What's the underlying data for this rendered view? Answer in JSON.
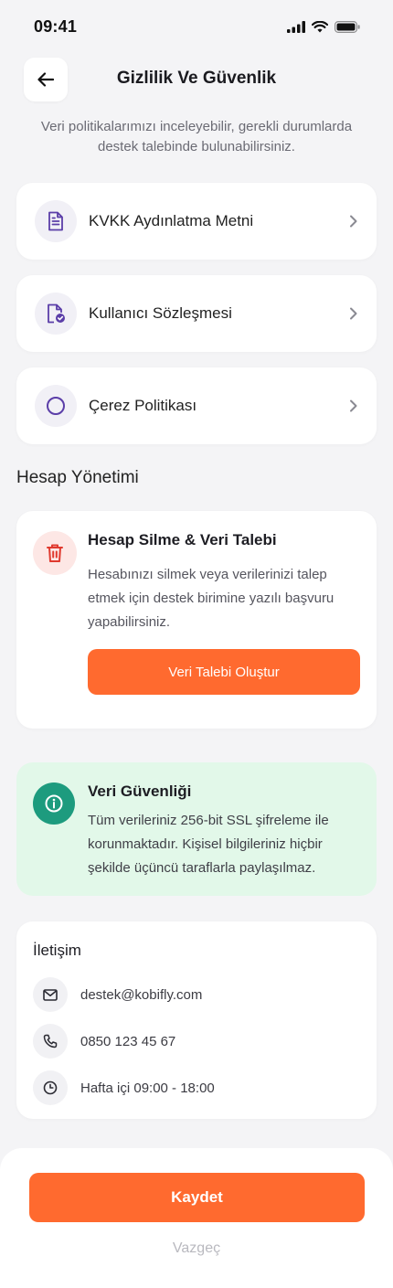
{
  "status_bar": {
    "time": "09:41"
  },
  "header": {
    "title": "Gizlilik Ve Güvenlik"
  },
  "subtitle": "Veri politikalarımızı inceleyebilir, gerekli durumlarda destek talebinde bulunabilirsiniz.",
  "menu_items": [
    {
      "label": "KVKK Aydınlatma Metni",
      "icon": "document-icon"
    },
    {
      "label": "Kullanıcı Sözleşmesi",
      "icon": "document-check-icon"
    },
    {
      "label": "Çerez Politikası",
      "icon": "circle-icon"
    }
  ],
  "account_section": {
    "title": "Hesap Yönetimi",
    "card_title": "Hesap Silme & Veri Talebi",
    "card_desc": "Hesabınızı silmek veya verilerinizi talep etmek için destek birimine yazılı başvuru yapabilirsiniz.",
    "button_label": "Veri Talebi Oluştur"
  },
  "security": {
    "title": "Veri Güvenliği",
    "desc": "Tüm verileriniz 256-bit SSL şifreleme ile korunmaktadır. Kişisel bilgileriniz hiçbir şekilde üçüncü taraflarla paylaşılmaz."
  },
  "contact": {
    "title": "İletişim",
    "email": "destek@kobifly.com",
    "phone": "0850 123 45 67",
    "hours": "Hafta içi 09:00 - 18:00"
  },
  "footer": {
    "save_label": "Kaydet",
    "cancel_label": "Vazgeç"
  },
  "colors": {
    "accent": "#ff6a2f",
    "purple_icon": "#5b3ea8",
    "danger": "#e03a2f",
    "success": "#1d9b7e",
    "background": "#f4f4f6"
  }
}
